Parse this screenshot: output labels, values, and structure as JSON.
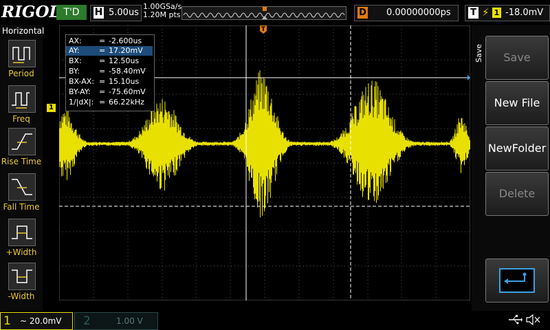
{
  "brand": "RIGOL",
  "topbar": {
    "status": "T'D",
    "horizontal_label": "H",
    "timebase": "5.00us",
    "sample_rate": "1.00GSa/s",
    "memory_depth": "1.20M pts",
    "delay_label": "D",
    "delay_value": "0.00000000ps",
    "trigger_label": "T",
    "trigger_source": "1",
    "trigger_level": "-18.0mV"
  },
  "left_panel": {
    "title": "Horizontal",
    "items": [
      {
        "label": "Period",
        "icon": "period-icon"
      },
      {
        "label": "Freq",
        "icon": "freq-icon"
      },
      {
        "label": "Rise Time",
        "icon": "rise-time-icon"
      },
      {
        "label": "Fall Time",
        "icon": "fall-time-icon"
      },
      {
        "label": "+Width",
        "icon": "pos-width-icon"
      },
      {
        "label": "-Width",
        "icon": "neg-width-icon"
      }
    ]
  },
  "measurements": [
    {
      "key": "AX:",
      "value": "-2.600us"
    },
    {
      "key": "AY:",
      "value": "17.20mV"
    },
    {
      "key": "BX:",
      "value": "12.50us"
    },
    {
      "key": "BY:",
      "value": "-58.40mV"
    },
    {
      "key": "BX-AX:",
      "value": "15.10us"
    },
    {
      "key": "BY-AY:",
      "value": "-75.60mV"
    },
    {
      "key": "1/|dX|:",
      "value": "66.22kHz"
    }
  ],
  "markers": {
    "channel": "1",
    "trigger": "T"
  },
  "right_menu": {
    "title": "Save",
    "buttons": [
      {
        "label": "Save",
        "enabled": false
      },
      {
        "label": "New File",
        "enabled": true
      },
      {
        "label": "NewFolder",
        "enabled": true
      },
      {
        "label": "Delete",
        "enabled": false
      }
    ],
    "back_icon": "return-arrow-icon"
  },
  "bottombar": {
    "ch1_number": "1",
    "ch1_scale": "~ 20.0mV",
    "ch2_number": "2",
    "ch2_scale": "1.00 V",
    "usb_icon": "usb-icon",
    "sound_icon": "speaker-mute-icon"
  },
  "colors": {
    "trace": "#e8e000",
    "cursor": "#ffffff",
    "trigger": "#e07a10",
    "selected_row": "#1d4c7a"
  }
}
